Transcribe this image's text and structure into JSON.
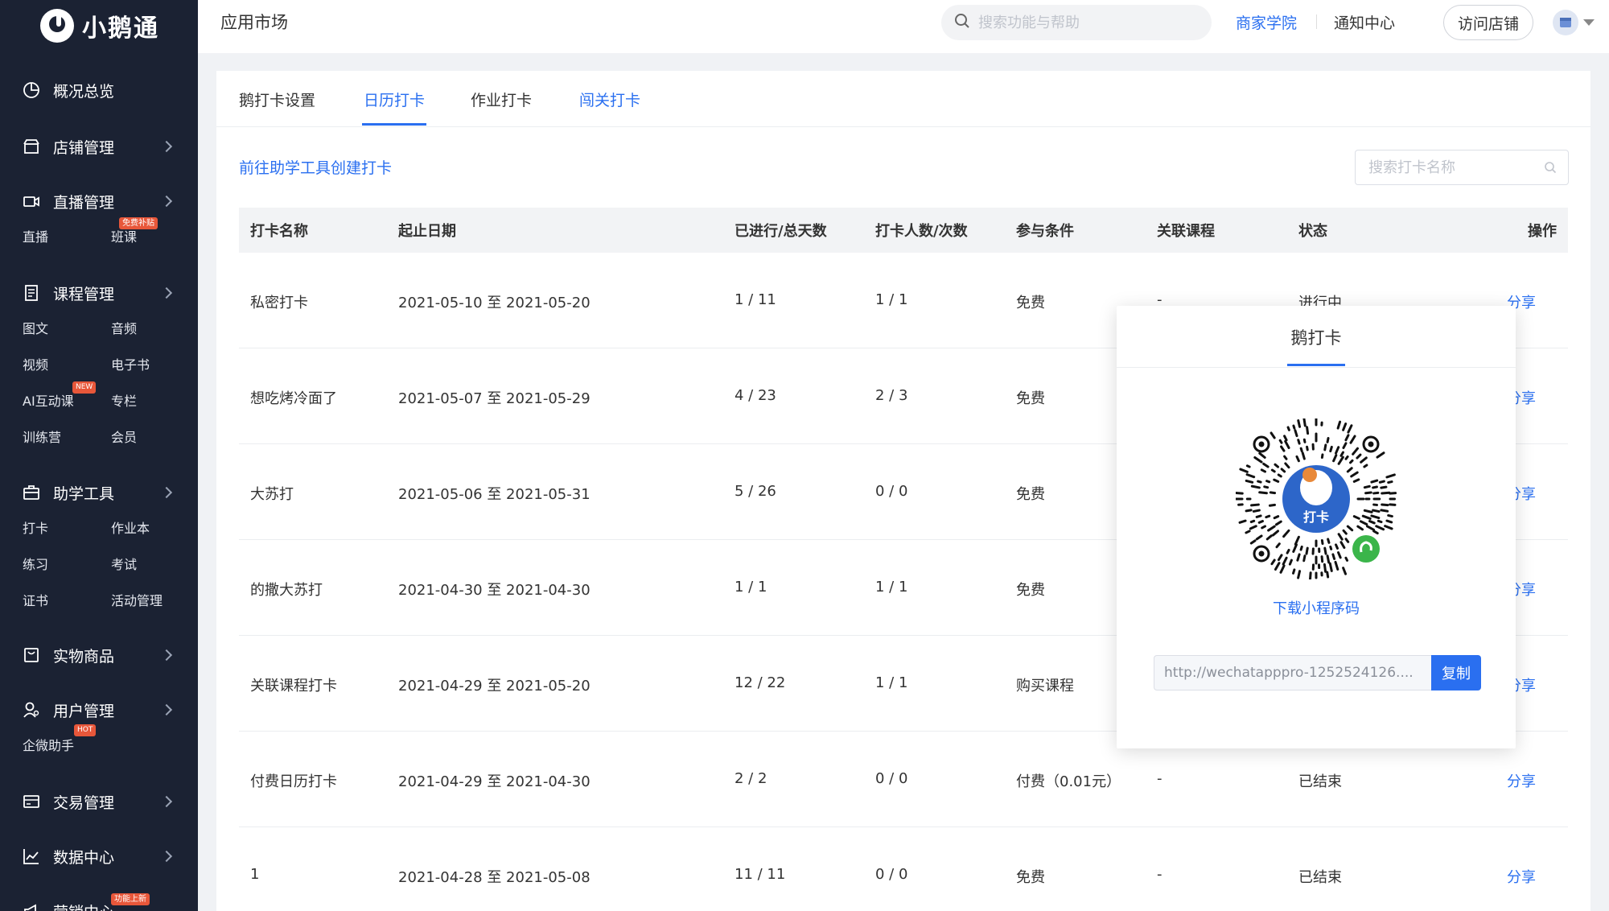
{
  "brand": {
    "name": "小鹅通"
  },
  "sidebar": {
    "groups": [
      {
        "label": "概况总览",
        "icon": "dashboard-icon"
      },
      {
        "label": "店铺管理",
        "icon": "store-icon"
      },
      {
        "label": "直播管理",
        "icon": "video-icon",
        "items": [
          {
            "label": "直播"
          },
          {
            "label": "班课",
            "badge": "免费补贴"
          }
        ]
      },
      {
        "label": "课程管理",
        "icon": "book-icon",
        "items": [
          {
            "label": "图文"
          },
          {
            "label": "音频"
          },
          {
            "label": "视频"
          },
          {
            "label": "电子书"
          },
          {
            "label": "AI互动课",
            "badge": "NEW"
          },
          {
            "label": "专栏"
          },
          {
            "label": "训练营"
          },
          {
            "label": "会员"
          }
        ]
      },
      {
        "label": "助学工具",
        "icon": "toolbox-icon",
        "items": [
          {
            "label": "打卡"
          },
          {
            "label": "作业本"
          },
          {
            "label": "练习"
          },
          {
            "label": "考试"
          },
          {
            "label": "证书"
          },
          {
            "label": "活动管理"
          }
        ]
      },
      {
        "label": "实物商品",
        "icon": "bag-icon"
      },
      {
        "label": "用户管理",
        "icon": "user-icon",
        "items": [
          {
            "label": "企微助手",
            "badge": "HOT"
          }
        ]
      },
      {
        "label": "交易管理",
        "icon": "card-icon"
      },
      {
        "label": "数据中心",
        "icon": "chart-icon"
      },
      {
        "label": "营销中心",
        "icon": "megaphone-icon",
        "badge": "功能上新"
      }
    ]
  },
  "header": {
    "title": "应用市场",
    "search_placeholder": "搜索功能与帮助",
    "academy": "商家学院",
    "notifications": "通知中心",
    "visit_store": "访问店铺"
  },
  "tabs": [
    "鹅打卡设置",
    "日历打卡",
    "作业打卡",
    "闯关打卡"
  ],
  "active_tab": "日历打卡",
  "toolbar": {
    "create_link": "前往助学工具创建打卡",
    "search_placeholder": "搜索打卡名称"
  },
  "table": {
    "columns": [
      "打卡名称",
      "起止日期",
      "已进行/总天数",
      "打卡人数/次数",
      "参与条件",
      "关联课程",
      "状态",
      "操作"
    ],
    "rows": [
      {
        "name": "私密打卡",
        "dates": "2021-05-10 至 2021-05-20",
        "progress": "1 / 11",
        "checkins": "1 / 1",
        "condition": "免费",
        "course": "-",
        "status": "进行中",
        "action": "分享"
      },
      {
        "name": "想吃烤冷面了",
        "dates": "2021-05-07 至 2021-05-29",
        "progress": "4 / 23",
        "checkins": "2 / 3",
        "condition": "免费",
        "course": "",
        "status": "",
        "action": "分享"
      },
      {
        "name": "大苏打",
        "dates": "2021-05-06 至 2021-05-31",
        "progress": "5 / 26",
        "checkins": "0 / 0",
        "condition": "免费",
        "course": "",
        "status": "",
        "action": "分享"
      },
      {
        "name": "的撒大苏打",
        "dates": "2021-04-30 至 2021-04-30",
        "progress": "1 / 1",
        "checkins": "1 / 1",
        "condition": "免费",
        "course": "",
        "status": "",
        "action": "分享"
      },
      {
        "name": "关联课程打卡",
        "dates": "2021-04-29 至 2021-05-20",
        "progress": "12 / 22",
        "checkins": "1 / 1",
        "condition": "购买课程",
        "course": "",
        "status": "",
        "action": "分享"
      },
      {
        "name": "付费日历打卡",
        "dates": "2021-04-29 至 2021-04-30",
        "progress": "2 / 2",
        "checkins": "0 / 0",
        "condition": "付费（0.01元）",
        "course": "-",
        "status": "已结束",
        "action": "分享"
      },
      {
        "name": "1",
        "dates": "2021-04-28 至 2021-05-08",
        "progress": "11 / 11",
        "checkins": "0 / 0",
        "condition": "免费",
        "course": "-",
        "status": "已结束",
        "action": "分享"
      }
    ]
  },
  "popup": {
    "title": "鹅打卡",
    "qr_label": "打卡",
    "download": "下载小程序码",
    "url": "http://wechatapppro-1252524126....",
    "copy": "复制"
  },
  "colors": {
    "sidebar_bg": "#1b2233",
    "accent": "#2a6ff0",
    "badge": "#e8573a"
  }
}
